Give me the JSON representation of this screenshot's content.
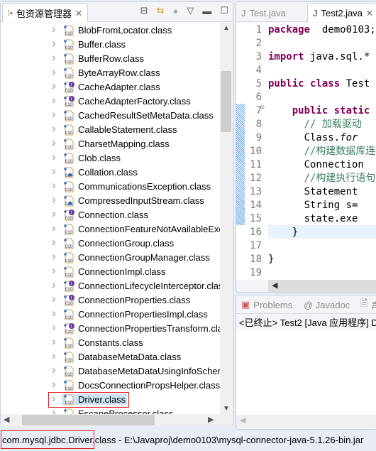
{
  "left_panel": {
    "title": "包资源管理器",
    "tools": [
      "collapse-all-icon",
      "link-with-editor-icon",
      "focus-icon",
      "view-menu-icon",
      "minimize-icon",
      "maximize-icon"
    ],
    "items": [
      {
        "label": "BlobFromLocator.class",
        "kind": "class"
      },
      {
        "label": "Buffer.class",
        "kind": "class"
      },
      {
        "label": "BufferRow.class",
        "kind": "class"
      },
      {
        "label": "ByteArrayRow.class",
        "kind": "class"
      },
      {
        "label": "CacheAdapter.class",
        "kind": "interface"
      },
      {
        "label": "CacheAdapterFactory.class",
        "kind": "interface"
      },
      {
        "label": "CachedResultSetMetaData.class",
        "kind": "class"
      },
      {
        "label": "CallableStatement.class",
        "kind": "class"
      },
      {
        "label": "CharsetMapping.class",
        "kind": "class"
      },
      {
        "label": "Clob.class",
        "kind": "class"
      },
      {
        "label": "Collation.class",
        "kind": "other"
      },
      {
        "label": "CommunicationsException.class",
        "kind": "class"
      },
      {
        "label": "CompressedInputStream.class",
        "kind": "other"
      },
      {
        "label": "Connection.class",
        "kind": "interface"
      },
      {
        "label": "ConnectionFeatureNotAvailableExc",
        "kind": "class"
      },
      {
        "label": "ConnectionGroup.class",
        "kind": "class"
      },
      {
        "label": "ConnectionGroupManager.class",
        "kind": "class"
      },
      {
        "label": "ConnectionImpl.class",
        "kind": "class"
      },
      {
        "label": "ConnectionLifecycleInterceptor.clas",
        "kind": "interface"
      },
      {
        "label": "ConnectionProperties.class",
        "kind": "interface"
      },
      {
        "label": "ConnectionPropertiesImpl.class",
        "kind": "class"
      },
      {
        "label": "ConnectionPropertiesTransform.cla",
        "kind": "interface"
      },
      {
        "label": "Constants.class",
        "kind": "class"
      },
      {
        "label": "DatabaseMetaData.class",
        "kind": "class"
      },
      {
        "label": "DatabaseMetaDataUsingInfoScher",
        "kind": "class"
      },
      {
        "label": "DocsConnectionPropsHelper.class",
        "kind": "class"
      },
      {
        "label": "Driver.class",
        "kind": "class",
        "selected": true
      },
      {
        "label": "EscapeProcessor.class",
        "kind": "class"
      }
    ]
  },
  "editor": {
    "tabs": [
      {
        "label": "Test.java",
        "active": false
      },
      {
        "label": "Test2.java",
        "active": true
      }
    ],
    "lines": [
      {
        "n": "1",
        "parts": [
          [
            "kw",
            "package"
          ],
          [
            "",
            "  demo0103;"
          ]
        ]
      },
      {
        "n": "2",
        "parts": []
      },
      {
        "n": "3",
        "parts": [
          [
            "kw",
            "import"
          ],
          [
            "",
            " java.sql.*"
          ]
        ]
      },
      {
        "n": "4",
        "parts": []
      },
      {
        "n": "5",
        "parts": [
          [
            "kw",
            "public"
          ],
          [
            "",
            " "
          ],
          [
            "kw",
            "class"
          ],
          [
            "",
            " Test"
          ]
        ]
      },
      {
        "n": "6",
        "parts": []
      },
      {
        "n": "7",
        "parts": [
          [
            "",
            "    "
          ],
          [
            "kw",
            "public"
          ],
          [
            "",
            " "
          ],
          [
            "kw",
            "static"
          ]
        ]
      },
      {
        "n": "8",
        "parts": [
          [
            "",
            "      "
          ],
          [
            "cm",
            "// 加载驱动"
          ]
        ]
      },
      {
        "n": "9",
        "parts": [
          [
            "",
            "      Class."
          ],
          [
            "it",
            "for"
          ]
        ]
      },
      {
        "n": "10",
        "parts": [
          [
            "",
            "      "
          ],
          [
            "cm",
            "//构建数据库连"
          ]
        ]
      },
      {
        "n": "11",
        "parts": [
          [
            "",
            "      Connection"
          ]
        ]
      },
      {
        "n": "12",
        "parts": [
          [
            "",
            "      "
          ],
          [
            "cm",
            "//构建执行语句"
          ]
        ]
      },
      {
        "n": "13",
        "parts": [
          [
            "",
            "      Statement"
          ]
        ]
      },
      {
        "n": "14",
        "parts": [
          [
            "",
            "      String s="
          ]
        ]
      },
      {
        "n": "15",
        "parts": [
          [
            "",
            "      state.exe"
          ]
        ]
      },
      {
        "n": "16",
        "parts": [
          [
            "",
            "    }"
          ]
        ]
      },
      {
        "n": "17",
        "parts": []
      },
      {
        "n": "18",
        "parts": [
          [
            "",
            "}"
          ]
        ]
      },
      {
        "n": "19",
        "parts": []
      }
    ]
  },
  "bottom_panel": {
    "tabs": [
      "Problems",
      "@ Javadoc",
      "声"
    ],
    "console": "<已终止> Test2 [Java 应用程序] D:"
  },
  "status": {
    "text": "com.mysql.jdbc.Driver.class - E:\\Javaproj\\demo0103\\mysql-connector-java-5.1.26-bin.jar"
  },
  "colors": {
    "highlight": "#e02020",
    "selection": "#cce4f7",
    "keyword": "#7f0055",
    "comment": "#3f7f5f"
  }
}
